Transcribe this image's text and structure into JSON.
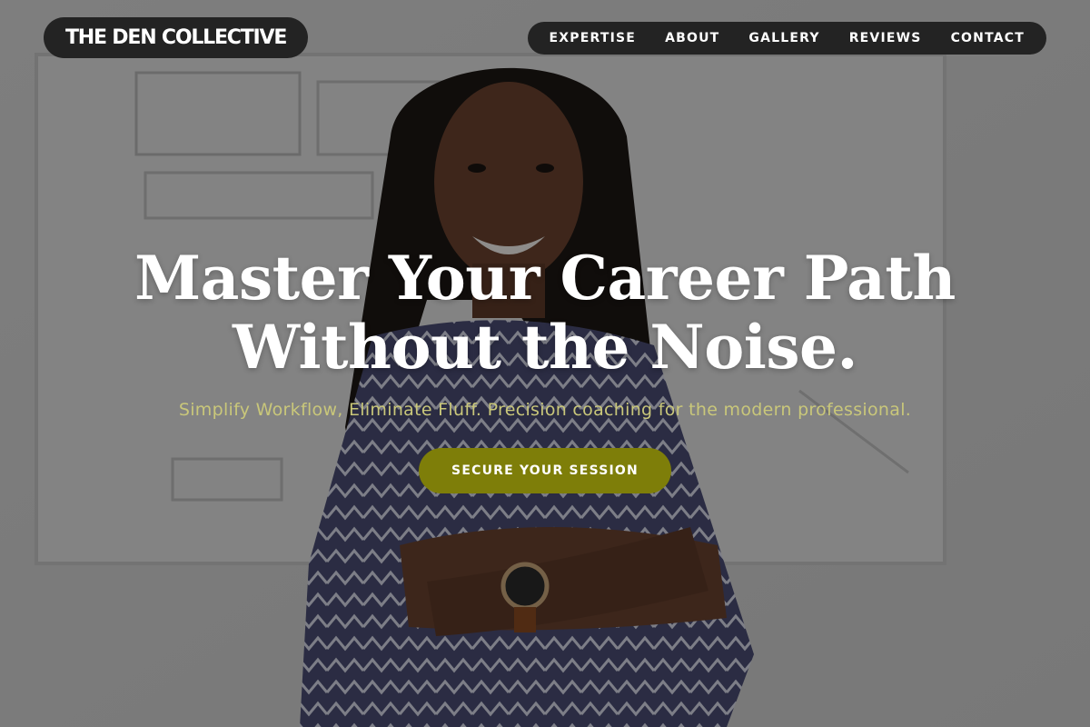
{
  "header": {
    "logo_text": "THE DEN COLLECTIVE",
    "nav": [
      {
        "label": "EXPERTISE"
      },
      {
        "label": "ABOUT"
      },
      {
        "label": "GALLERY"
      },
      {
        "label": "REVIEWS"
      },
      {
        "label": "CONTACT"
      }
    ]
  },
  "hero": {
    "headline_line1": "Master Your Career Path",
    "headline_line2": "Without the Noise.",
    "subheadline": "Simplify Workflow, Eliminate Fluff. Precision coaching for the modern professional.",
    "cta_label": "SECURE YOUR SESSION",
    "background_image": "smiling-woman-arms-crossed-whiteboard-photo"
  },
  "colors": {
    "pill_bg": "#232323",
    "accent_olive": "#7e7e09",
    "subheadline_color": "#c9c77a",
    "text_white": "#ffffff"
  }
}
